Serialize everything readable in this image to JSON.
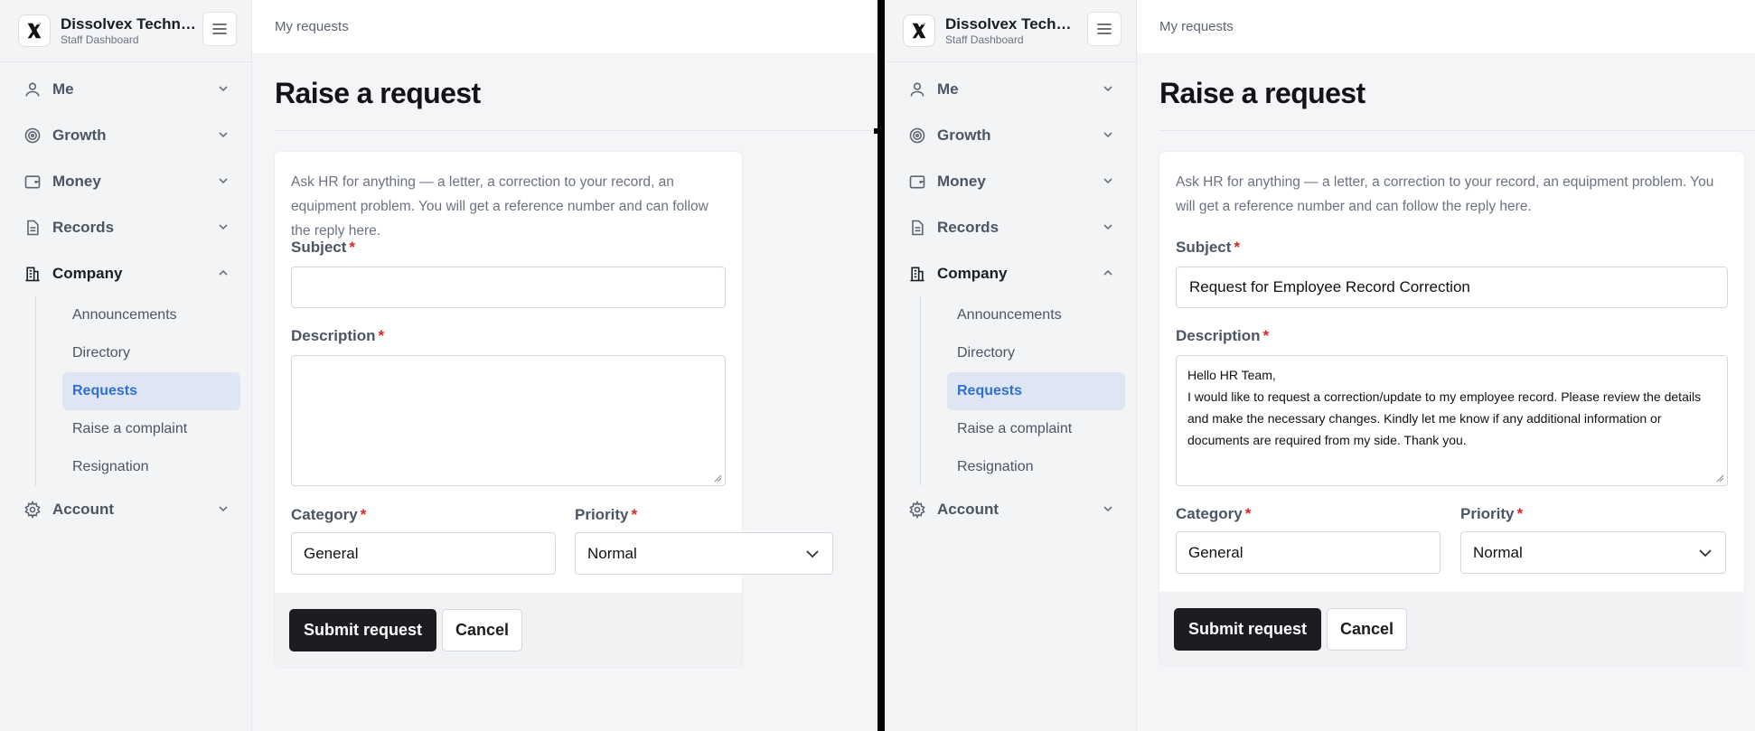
{
  "brand": {
    "name": "Dissolvex Technologies",
    "subtitle": "Staff Dashboard"
  },
  "nav": {
    "items": [
      {
        "label": "Me",
        "icon": "user-icon"
      },
      {
        "label": "Growth",
        "icon": "target-icon"
      },
      {
        "label": "Money",
        "icon": "wallet-icon"
      },
      {
        "label": "Records",
        "icon": "document-icon"
      },
      {
        "label": "Company",
        "icon": "building-icon"
      },
      {
        "label": "Account",
        "icon": "gear-icon"
      }
    ],
    "company_sub": [
      "Announcements",
      "Directory",
      "Requests",
      "Raise a complaint",
      "Resignation"
    ]
  },
  "breadcrumb": "My requests",
  "page_title": "Raise a request",
  "form": {
    "intro": "Ask HR for anything — a letter, a correction to your record, an equipment problem. You will get a reference number and can follow the reply here.",
    "subject_label": "Subject",
    "description_label": "Description",
    "category_label": "Category",
    "priority_label": "Priority",
    "required_mark": "*",
    "submit_label": "Submit request",
    "cancel_label": "Cancel"
  },
  "screens": [
    {
      "subject_value": "",
      "description_value": "",
      "category_value": "General",
      "priority_value": "Normal"
    },
    {
      "subject_value": "Request for Employee Record Correction",
      "description_value": "Hello HR Team,\nI would like to request a correction/update to my employee record. Please review the details and make the necessary changes. Kindly let me know if any additional information or documents are required from my side. Thank you.",
      "category_value": "General",
      "priority_value": "Normal"
    }
  ],
  "colors": {
    "accent": "#2f6fd6",
    "required": "#dc2626",
    "primary_button": "#1b1d21"
  }
}
